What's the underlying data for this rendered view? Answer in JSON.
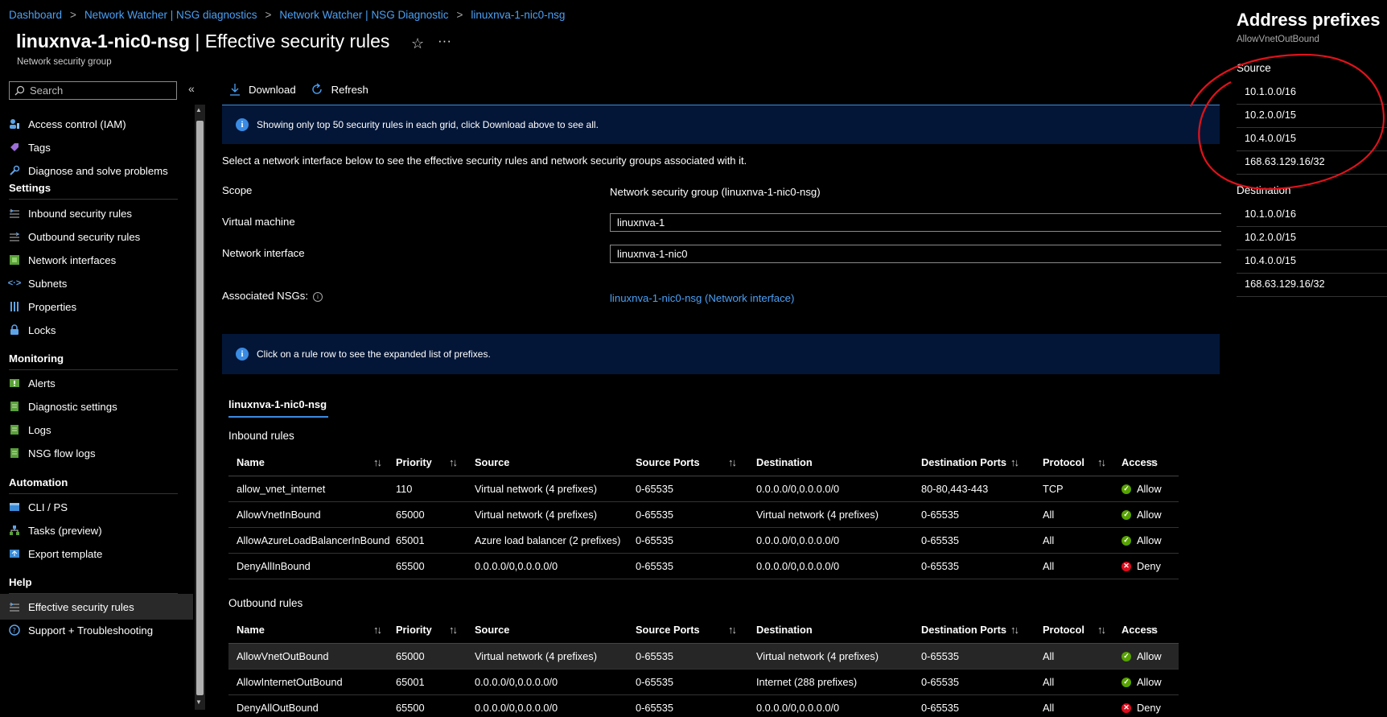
{
  "breadcrumb": [
    "Dashboard",
    "Network Watcher | NSG diagnostics",
    "Network Watcher | NSG Diagnostic",
    "linuxnva-1-nic0-nsg"
  ],
  "header": {
    "title_bold": "linuxnva-1-nic0-nsg",
    "title_rest": " | Effective security rules",
    "subtitle": "Network security group"
  },
  "search": {
    "placeholder": "Search"
  },
  "sidebar": {
    "items_top": [
      {
        "label": "Access control (IAM)",
        "icon": "iam-icon"
      },
      {
        "label": "Tags",
        "icon": "tag-icon"
      },
      {
        "label": "Diagnose and solve problems",
        "icon": "wrench-icon"
      }
    ],
    "sections": [
      {
        "title": "Settings",
        "items": [
          {
            "label": "Inbound security rules",
            "icon": "inbound-rules-icon"
          },
          {
            "label": "Outbound security rules",
            "icon": "outbound-rules-icon"
          },
          {
            "label": "Network interfaces",
            "icon": "network-interface-icon"
          },
          {
            "label": "Subnets",
            "icon": "subnet-icon"
          },
          {
            "label": "Properties",
            "icon": "properties-icon"
          },
          {
            "label": "Locks",
            "icon": "lock-icon"
          }
        ]
      },
      {
        "title": "Monitoring",
        "items": [
          {
            "label": "Alerts",
            "icon": "alert-icon"
          },
          {
            "label": "Diagnostic settings",
            "icon": "diagnostic-settings-icon"
          },
          {
            "label": "Logs",
            "icon": "logs-icon"
          },
          {
            "label": "NSG flow logs",
            "icon": "flow-logs-icon"
          }
        ]
      },
      {
        "title": "Automation",
        "items": [
          {
            "label": "CLI / PS",
            "icon": "cli-icon"
          },
          {
            "label": "Tasks (preview)",
            "icon": "tasks-icon"
          },
          {
            "label": "Export template",
            "icon": "export-template-icon"
          }
        ]
      },
      {
        "title": "Help",
        "items": [
          {
            "label": "Effective security rules",
            "icon": "effective-rules-icon",
            "active": true
          },
          {
            "label": "Support + Troubleshooting",
            "icon": "help-icon"
          }
        ]
      }
    ]
  },
  "toolbar": {
    "download": "Download",
    "refresh": "Refresh"
  },
  "banner_top": "Showing only top 50 security rules in each grid, click Download above to see all.",
  "select_text": "Select a network interface below to see the effective security rules and network security groups associated with it.",
  "form": {
    "scope_label": "Scope",
    "scope_value": "Network security group (linuxnva-1-nic0-nsg)",
    "vm_label": "Virtual machine",
    "vm_value": "linuxnva-1",
    "nic_label": "Network interface",
    "nic_value": "linuxnva-1-nic0",
    "assoc_label": "Associated NSGs:",
    "assoc_value": "linuxnva-1-nic0-nsg (Network interface)"
  },
  "banner_rules": "Click on a rule row to see the expanded list of prefixes.",
  "nsg_tab": "linuxnva-1-nic0-nsg",
  "columns": [
    "Name",
    "Priority",
    "Source",
    "Source Ports",
    "Destination",
    "Destination Ports",
    "Protocol",
    "Access"
  ],
  "inbound": {
    "heading": "Inbound rules",
    "rows": [
      {
        "name": "allow_vnet_internet",
        "priority": "110",
        "source": "Virtual network (4 prefixes)",
        "source_ports": "0-65535",
        "destination": "0.0.0.0/0,0.0.0.0/0",
        "dest_ports": "80-80,443-443",
        "protocol": "TCP",
        "access": "Allow"
      },
      {
        "name": "AllowVnetInBound",
        "priority": "65000",
        "source": "Virtual network (4 prefixes)",
        "source_ports": "0-65535",
        "destination": "Virtual network (4 prefixes)",
        "dest_ports": "0-65535",
        "protocol": "All",
        "access": "Allow"
      },
      {
        "name": "AllowAzureLoadBalancerInBound",
        "priority": "65001",
        "source": "Azure load balancer (2 prefixes)",
        "source_ports": "0-65535",
        "destination": "0.0.0.0/0,0.0.0.0/0",
        "dest_ports": "0-65535",
        "protocol": "All",
        "access": "Allow"
      },
      {
        "name": "DenyAllInBound",
        "priority": "65500",
        "source": "0.0.0.0/0,0.0.0.0/0",
        "source_ports": "0-65535",
        "destination": "0.0.0.0/0,0.0.0.0/0",
        "dest_ports": "0-65535",
        "protocol": "All",
        "access": "Deny"
      }
    ]
  },
  "outbound": {
    "heading": "Outbound rules",
    "rows": [
      {
        "name": "AllowVnetOutBound",
        "priority": "65000",
        "source": "Virtual network (4 prefixes)",
        "source_ports": "0-65535",
        "destination": "Virtual network (4 prefixes)",
        "dest_ports": "0-65535",
        "protocol": "All",
        "access": "Allow",
        "selected": true
      },
      {
        "name": "AllowInternetOutBound",
        "priority": "65001",
        "source": "0.0.0.0/0,0.0.0.0/0",
        "source_ports": "0-65535",
        "destination": "Internet (288 prefixes)",
        "dest_ports": "0-65535",
        "protocol": "All",
        "access": "Allow"
      },
      {
        "name": "DenyAllOutBound",
        "priority": "65500",
        "source": "0.0.0.0/0,0.0.0.0/0",
        "source_ports": "0-65535",
        "destination": "0.0.0.0/0,0.0.0.0/0",
        "dest_ports": "0-65535",
        "protocol": "All",
        "access": "Deny"
      }
    ]
  },
  "panel": {
    "title": "Address prefixes",
    "subtitle": "AllowVnetOutBound",
    "source_heading": "Source",
    "source": [
      "10.1.0.0/16",
      "10.2.0.0/15",
      "10.4.0.0/15",
      "168.63.129.16/32"
    ],
    "destination_heading": "Destination",
    "destination": [
      "10.1.0.0/16",
      "10.2.0.0/15",
      "10.4.0.0/15",
      "168.63.129.16/32"
    ]
  },
  "colors": {
    "accent": "#3a8be3",
    "link": "#4ba0f5",
    "banner_bg": "#031638",
    "allow": "#57a300",
    "deny": "#e00b1c",
    "annotation": "#e0121a"
  }
}
